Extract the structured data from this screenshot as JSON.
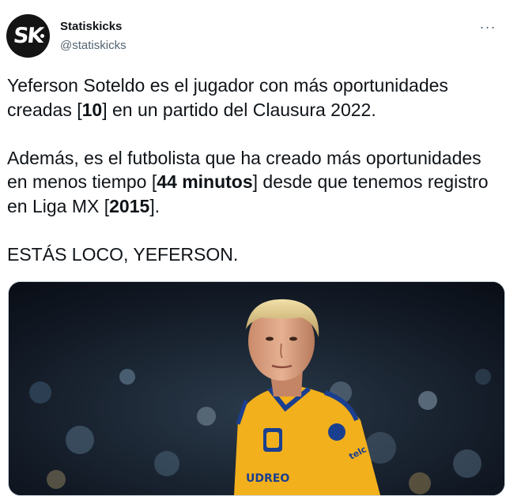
{
  "author": {
    "display_name": "Statiskicks",
    "handle": "@statiskicks",
    "avatar_text": "SK"
  },
  "more_label": "···",
  "tweet": {
    "p1_a": "Yeferson Soteldo es el jugador con más oportunidades creadas [",
    "p1_b1": "10",
    "p1_c": "] en un partido del Clausura 2022.",
    "p2_a": "Además, es el futbolista que ha creado más oportunidades en menos tiempo [",
    "p2_b1": "44 minutos",
    "p2_c": "] desde que tenemos registro en Liga MX [",
    "p2_b2": "2015",
    "p2_d": "].",
    "p3": "ESTÁS LOCO, YEFERSON."
  },
  "media": {
    "description_icon": "photo",
    "jersey_text": "UDREO"
  },
  "colors": {
    "jersey": "#f2b01c",
    "jersey_trim": "#1b3f8f",
    "text": "#0f1419",
    "secondary": "#536471"
  }
}
